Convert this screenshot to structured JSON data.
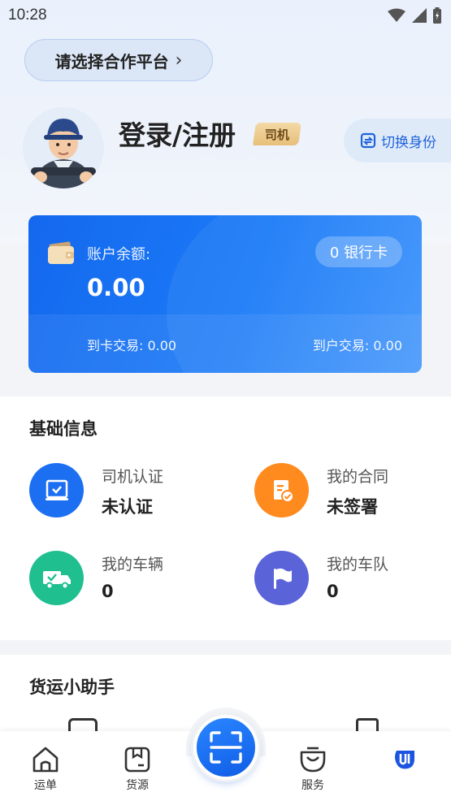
{
  "status_bar": {
    "time": "10:28"
  },
  "header": {
    "platform_select": "请选择合作平台",
    "login_title": "登录/注册",
    "role_badge": "司机",
    "switch_identity": "切换身份"
  },
  "balance": {
    "label": "账户余额:",
    "value": "0.00",
    "bank_card": "0 银行卡",
    "card_trade": "到卡交易: 0.00",
    "account_trade": "到户交易: 0.00"
  },
  "basic_info": {
    "title": "基础信息",
    "items": [
      {
        "label": "司机认证",
        "value": "未认证",
        "icon": "driver-cert-icon",
        "color": "#1d6ff2"
      },
      {
        "label": "我的合同",
        "value": "未签署",
        "icon": "contract-icon",
        "color": "#ff8a1e"
      },
      {
        "label": "我的车辆",
        "value": "0",
        "icon": "truck-icon",
        "color": "#1fbf8f"
      },
      {
        "label": "我的车队",
        "value": "0",
        "icon": "flag-icon",
        "color": "#5a63d8"
      }
    ]
  },
  "helper": {
    "title": "货运小助手"
  },
  "tabbar": {
    "items": [
      {
        "label": "运单",
        "icon": "home-icon"
      },
      {
        "label": "货源",
        "icon": "box-icon"
      },
      {
        "label": "服务",
        "icon": "service-bag-icon"
      }
    ],
    "scan_icon": "scan-icon",
    "profile_icon": "profile-logo-icon"
  }
}
